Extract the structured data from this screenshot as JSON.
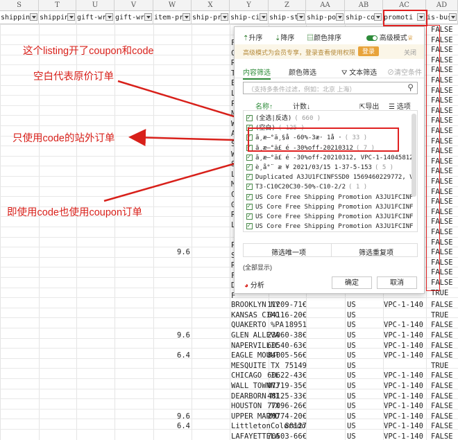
{
  "columns": [
    {
      "letter": "S",
      "field": "shippin"
    },
    {
      "letter": "T",
      "field": "shippin"
    },
    {
      "letter": "U",
      "field": "gift-wr"
    },
    {
      "letter": "V",
      "field": "gift-wr"
    },
    {
      "letter": "W",
      "field": "item-pr"
    },
    {
      "letter": "X",
      "field": "ship-pr"
    },
    {
      "letter": "Y",
      "field": "ship-ci"
    },
    {
      "letter": "Z",
      "field": "ship-st"
    },
    {
      "letter": "AA",
      "field": "ship-po"
    },
    {
      "letter": "AB",
      "field": "ship-co"
    },
    {
      "letter": "AC",
      "field": "promoti"
    },
    {
      "letter": "AD",
      "field": "is-busi"
    }
  ],
  "annotations": {
    "a1": "这个listing开了coupon和code",
    "a2": "空白代表原价订单",
    "a3": "只使用code的站外订单",
    "a4": "即使用code也使用coupon订单"
  },
  "w_values_top": [
    {
      "row": 22,
      "v": "9.6"
    }
  ],
  "lower_rows": [
    {
      "w": "",
      "city": "BROOKLYN",
      "st": "NY",
      "zip": "11209-71€",
      "co": "US",
      "promo": "VPC-1-140",
      "biz": "FALSE"
    },
    {
      "w": "",
      "city": "KANSAS CI",
      "st": "MO",
      "zip": "64116-20€",
      "co": "US",
      "promo": "",
      "biz": "TRUE"
    },
    {
      "w": "",
      "city": "QUAKERTO",
      "st": "%PA",
      "zip": "18951",
      "co": "US",
      "promo": "VPC-1-140",
      "biz": "FALSE"
    },
    {
      "w": "9.6",
      "city": "GLEN ALLE",
      "st": "VA",
      "zip": "23060-38€",
      "co": "US",
      "promo": "VPC-1-140",
      "biz": "FALSE"
    },
    {
      "w": "",
      "city": "NAPERVILL",
      "st": "IL",
      "zip": "60540-63€",
      "co": "US",
      "promo": "VPC-1-140",
      "biz": "FALSE"
    },
    {
      "w": "6.4",
      "city": "EAGLE MOU",
      "st": "UT",
      "zip": "84005-56€",
      "co": "US",
      "promo": "VPC-1-140",
      "biz": "FALSE"
    },
    {
      "w": "",
      "city": "MESQUITE",
      "st": "TX",
      "zip": "75149",
      "co": "US",
      "promo": "",
      "biz": "TRUE"
    },
    {
      "w": "",
      "city": "CHICAGO",
      "st": "IL",
      "zip": "60622-43€",
      "co": "US",
      "promo": "VPC-1-140",
      "biz": "FALSE"
    },
    {
      "w": "",
      "city": "WALL TOWN",
      "st": "NJ",
      "zip": "07719-35€",
      "co": "US",
      "promo": "VPC-1-140",
      "biz": "FALSE"
    },
    {
      "w": "",
      "city": "DEARBORN",
      "st": "MI",
      "zip": "48125-33€",
      "co": "US",
      "promo": "VPC-1-140",
      "biz": "FALSE"
    },
    {
      "w": "",
      "city": "HOUSTON",
      "st": "TX",
      "zip": "77096-26€",
      "co": "US",
      "promo": "VPC-1-140",
      "biz": "FALSE"
    },
    {
      "w": "9.6",
      "city": "UPPER MAR",
      "st": "MD",
      "zip": "20774-20€",
      "co": "US",
      "promo": "VPC-1-140",
      "biz": "FALSE"
    },
    {
      "w": "6.4",
      "city": "Littleton",
      "st": "Colorado",
      "zip": "80127",
      "co": "US",
      "promo": "VPC-1-140",
      "biz": "FALSE"
    },
    {
      "w": "",
      "city": "LAFAYETTE",
      "st": "LA",
      "zip": "70503-66€",
      "co": "US",
      "promo": "VPC-1-140",
      "biz": "FALSE"
    }
  ],
  "y_letters": [
    "F",
    "C",
    "R",
    "T",
    "E",
    "L",
    "P",
    "N",
    "W",
    "A",
    "S",
    "W",
    "S",
    "L",
    "M",
    "C",
    "G",
    "R",
    "L",
    "",
    "P",
    "S",
    "R",
    "F",
    "D",
    "F"
  ],
  "ad_top": [
    "FALSE",
    "FALSE",
    "FALSE",
    "FALSE",
    "FALSE",
    "FALSE",
    "FALSE",
    "FALSE",
    "FALSE",
    "FALSE",
    "FALSE",
    "FALSE",
    "FALSE",
    "FALSE",
    "FALSE",
    "FALSE",
    "FALSE",
    "FALSE",
    "FALSE",
    "FALSE",
    "FALSE",
    "FALSE",
    "FALSE",
    "FALSE",
    "FALSE",
    "FALSE",
    "TRUE"
  ],
  "dialog": {
    "sort_asc": "升序",
    "sort_desc": "降序",
    "sort_color": "颜色排序",
    "advanced": "高级模式",
    "vip_notice": "高级模式为会员专享，登录查看使用权限",
    "login": "登录",
    "close": "关闭",
    "tab_content": "内容筛选",
    "tab_color": "颜色筛选",
    "text_filter": "文本筛选",
    "clear": "清空条件",
    "search_placeholder": "（支持多条件过滤，例如：北京 上海）",
    "name_col": "名称↑",
    "count_col": "计数↓",
    "export": "导出",
    "options": "选项",
    "items": [
      {
        "label": "(全选|反选)",
        "count": "( 660 )"
      },
      {
        "label": "(空白)",
        "count": "( 125 )"
      },
      {
        "label": "ã¸æ–°ä¸§å  -60%-3æ· 1å ·",
        "count": "( 33 )"
      },
      {
        "label": "ã¸æ–°ä£ é  -30%off-20210312",
        "count": "( 7 )"
      },
      {
        "label": "ã¸æ–°ä£ é  -30%off-20210312, VPC-1-140458122",
        "count": ""
      },
      {
        "label": "è¸å°¨ æ ¥ 2021/03/15 1-37-5-153",
        "count": "( 5 )"
      },
      {
        "label": "Duplicated A3JU1FCINFSSD0 1569460229772, VPC-",
        "count": ""
      },
      {
        "label": "T3-C10C20C30-50%-C10-2/2",
        "count": "( 1 )"
      },
      {
        "label": "US Core Free Shipping Promotion A3JU1FCINFSS",
        "count": ""
      },
      {
        "label": "US Core Free Shipping Promotion A3JU1FCINFSS",
        "count": ""
      },
      {
        "label": "US Core Free Shipping Promotion A3JU1FCINFSS",
        "count": ""
      },
      {
        "label": "US Core Free Shipping Promotion A3JU1FCINFSS",
        "count": ""
      }
    ],
    "filter_unique": "筛选唯一项",
    "filter_dup": "筛选重复项",
    "show_all": "(全部显示)",
    "analysis": "分析",
    "ok": "确定",
    "cancel": "取消"
  },
  "colors": {
    "red": "#d8201a",
    "green": "#2e8b3a"
  }
}
